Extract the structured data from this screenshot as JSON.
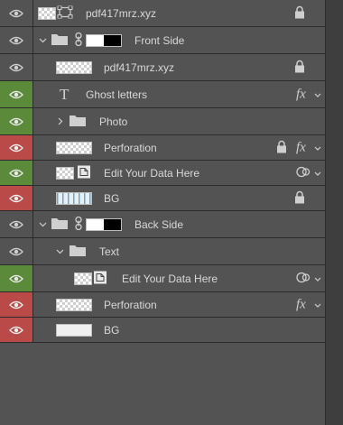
{
  "layers": [
    {
      "name": "pdf417mrz.xyz",
      "eye": "normal",
      "indent": 0,
      "type": "smart-frame",
      "lock": true
    },
    {
      "name": "Front Side",
      "eye": "normal",
      "indent": 0,
      "type": "group-mask",
      "expanded": true
    },
    {
      "name": "pdf417mrz.xyz",
      "eye": "normal",
      "indent": 1,
      "type": "raster",
      "lock": true
    },
    {
      "name": "Ghost letters",
      "eye": "green",
      "indent": 1,
      "type": "text",
      "fx": true
    },
    {
      "name": "Photo",
      "eye": "green",
      "indent": 1,
      "type": "group",
      "expanded": false
    },
    {
      "name": "Perforation",
      "eye": "red",
      "indent": 1,
      "type": "raster",
      "lock": true,
      "fx": true
    },
    {
      "name": "Edit Your Data Here",
      "eye": "green",
      "indent": 1,
      "type": "smart",
      "ring": true
    },
    {
      "name": "BG",
      "eye": "red",
      "indent": 1,
      "type": "raster-bg",
      "lock": true
    },
    {
      "name": "Back Side",
      "eye": "normal",
      "indent": 0,
      "type": "group-mask",
      "expanded": true
    },
    {
      "name": "Text",
      "eye": "normal",
      "indent": 1,
      "type": "group",
      "expanded": true
    },
    {
      "name": "Edit Your Data Here",
      "eye": "green",
      "indent": 2,
      "type": "smart",
      "ring": true
    },
    {
      "name": "Perforation",
      "eye": "red",
      "indent": 1,
      "type": "raster",
      "fx": true
    },
    {
      "name": "BG",
      "eye": "red",
      "indent": 1,
      "type": "raster-bg2"
    }
  ],
  "colors": {
    "panel": "#535353",
    "green": "#5b8a3a",
    "red": "#b94a48",
    "divider": "#2b2b2b"
  },
  "icons": {
    "eye": "eye-icon",
    "lock": "lock-icon",
    "fx": "fx-icon",
    "folder": "folder-icon",
    "chain": "chain-link-icon",
    "chevron": "chevron-icon",
    "smart": "smart-object-icon",
    "ring": "linked-ring-icon",
    "text": "text-layer-icon"
  },
  "fx_label": "fx",
  "text_icon_label": "T"
}
